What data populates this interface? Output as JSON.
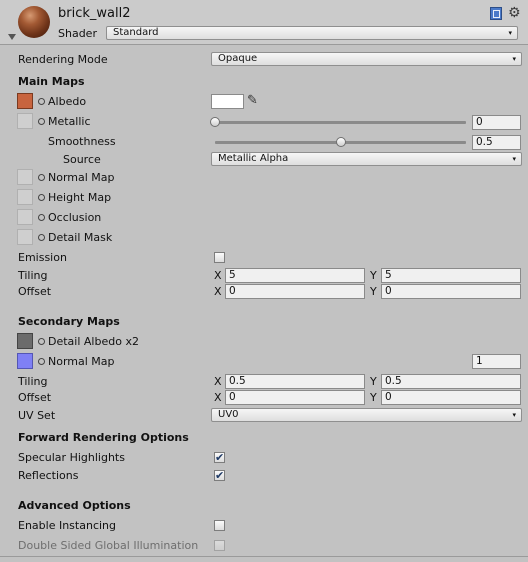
{
  "header": {
    "title": "brick_wall2",
    "shader_label": "Shader",
    "shader_value": "Standard"
  },
  "rendering_mode": {
    "label": "Rendering Mode",
    "value": "Opaque"
  },
  "main_maps": {
    "heading": "Main Maps",
    "albedo": "Albedo",
    "metallic": {
      "label": "Metallic",
      "value": "0",
      "slider_fraction": 0
    },
    "smoothness": {
      "label": "Smoothness",
      "value": "0.5",
      "slider_fraction": 0.5
    },
    "source": {
      "label": "Source",
      "value": "Metallic Alpha"
    },
    "normal_map": "Normal Map",
    "height_map": "Height Map",
    "occlusion": "Occlusion",
    "detail_mask": "Detail Mask",
    "emission": "Emission",
    "tiling": {
      "label": "Tiling",
      "x_label": "X",
      "x": "5",
      "y_label": "Y",
      "y": "5"
    },
    "offset": {
      "label": "Offset",
      "x_label": "X",
      "x": "0",
      "y_label": "Y",
      "y": "0"
    }
  },
  "secondary_maps": {
    "heading": "Secondary Maps",
    "detail_albedo": "Detail Albedo x2",
    "normal_map": {
      "label": "Normal Map",
      "value": "1"
    },
    "tiling": {
      "label": "Tiling",
      "x_label": "X",
      "x": "0.5",
      "y_label": "Y",
      "y": "0.5"
    },
    "offset": {
      "label": "Offset",
      "x_label": "X",
      "x": "0",
      "y_label": "Y",
      "y": "0"
    },
    "uv_set": {
      "label": "UV Set",
      "value": "UV0"
    }
  },
  "forward_rendering": {
    "heading": "Forward Rendering Options",
    "specular": {
      "label": "Specular Highlights",
      "checked": true
    },
    "reflections": {
      "label": "Reflections",
      "checked": true
    }
  },
  "advanced": {
    "heading": "Advanced Options",
    "instancing": {
      "label": "Enable Instancing",
      "checked": false
    },
    "double_sided_gi": {
      "label": "Double Sided Global Illumination",
      "checked": false
    }
  },
  "glyphs": {
    "dropdown_arrow": "▾",
    "checkmark": "✔",
    "gear": "⚙",
    "eyedropper": "✎"
  },
  "colors": {
    "albedo_tint": "#c8643e",
    "normal_map_tint": "#7f80f5",
    "detail_albedo_tint": "#6b6b6b",
    "albedo_color": "#ffffff"
  }
}
